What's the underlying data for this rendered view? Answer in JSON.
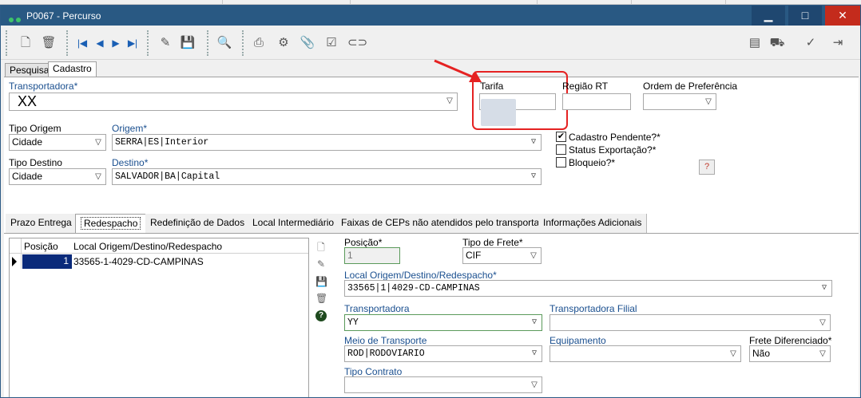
{
  "window": {
    "title": "P0067 - Percurso",
    "minimize": "▁",
    "maximize": "□",
    "close": "✕"
  },
  "toolbar": {
    "icons": [
      "new-doc-icon",
      "delete-icon",
      "first-record-icon",
      "previous-record-icon",
      "next-record-icon",
      "last-record-icon",
      "edit-icon",
      "save-icon",
      "search-record-icon",
      "print-icon",
      "settings-icon",
      "attach-icon",
      "check-icon",
      "link-icon",
      "report-icon",
      "truck-icon",
      "confirm-icon",
      "exit-icon"
    ]
  },
  "top_tabs": [
    {
      "label": "Pesquisa",
      "active": false
    },
    {
      "label": "Cadastro",
      "active": true
    }
  ],
  "form": {
    "transportadora": {
      "label": "Transportadora*",
      "value": "XX"
    },
    "tarifa": {
      "label": "Tarifa",
      "value": ""
    },
    "regiao_rt": {
      "label": "Região RT",
      "value": ""
    },
    "ordem_preferencia": {
      "label": "Ordem de Preferência",
      "value": ""
    },
    "tipo_origem": {
      "label": "Tipo Origem",
      "value": "Cidade"
    },
    "origem": {
      "label": "Origem*",
      "value": "SERRA|ES|Interior"
    },
    "tipo_destino": {
      "label": "Tipo Destino",
      "value": "Cidade"
    },
    "destino": {
      "label": "Destino*",
      "value": "SALVADOR|BA|Capital"
    },
    "cadastro_pendente": {
      "label": "Cadastro Pendente?*",
      "checked": true
    },
    "status_exportacao": {
      "label": "Status Exportação?*",
      "checked": false
    },
    "bloqueio": {
      "label": "Bloqueio?*",
      "checked": false
    },
    "help_button": "?"
  },
  "mid_tabs": [
    {
      "label": "Prazo Entrega",
      "active": false
    },
    {
      "label": "Redespacho",
      "active": true
    },
    {
      "label": "Redefinição de Dados",
      "active": false
    },
    {
      "label": "Local Intermediário",
      "active": false
    },
    {
      "label": "Faixas de CEPs não atendidos pelo transportador",
      "active": false
    },
    {
      "label": "Informações Adicionais",
      "active": false
    }
  ],
  "grid": {
    "columns": [
      "Posição",
      "Local Origem/Destino/Redespacho"
    ],
    "rows": [
      {
        "posicao": "1",
        "local": "33565-1-4029-CD-CAMPINAS"
      }
    ]
  },
  "redespacho": {
    "posicao": {
      "label": "Posição*",
      "value": "1"
    },
    "tipo_frete": {
      "label": "Tipo de Frete*",
      "value": "CIF"
    },
    "local": {
      "label": "Local Origem/Destino/Redespacho*",
      "value": "33565|1|4029-CD-CAMPINAS"
    },
    "transportadora": {
      "label": "Transportadora",
      "value": "YY"
    },
    "transportadora_filial": {
      "label": "Transportadora Filial",
      "value": ""
    },
    "meio_transporte": {
      "label": "Meio de Transporte",
      "value": "ROD|RODOVIARIO"
    },
    "equipamento": {
      "label": "Equipamento",
      "value": ""
    },
    "frete_diferenciado": {
      "label": "Frete Diferenciado*",
      "value": "Não"
    },
    "tipo_contrato": {
      "label": "Tipo Contrato",
      "value": ""
    }
  },
  "colors": {
    "titlebar": "#295983",
    "highlight": "#e52222",
    "selected_cell": "#0a2a7a"
  }
}
